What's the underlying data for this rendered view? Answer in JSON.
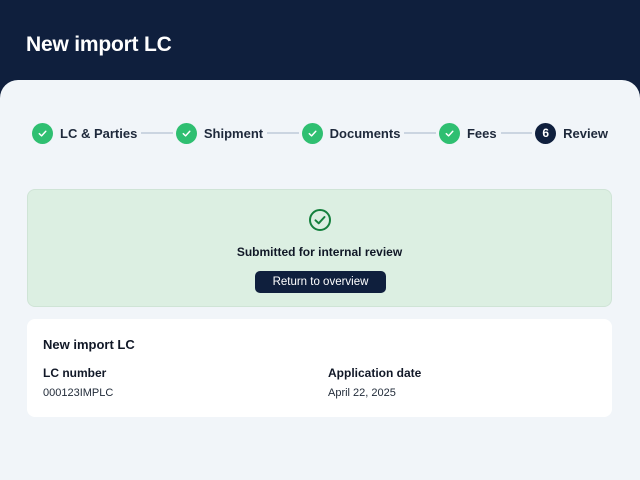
{
  "header": {
    "title": "New import LC"
  },
  "stepper": {
    "steps": [
      {
        "label": "LC & Parties",
        "status": "complete"
      },
      {
        "label": "Shipment",
        "status": "complete"
      },
      {
        "label": "Documents",
        "status": "complete"
      },
      {
        "label": "Fees",
        "status": "complete"
      },
      {
        "label": "Review",
        "status": "current",
        "number": "6"
      }
    ]
  },
  "success": {
    "icon": "check-circle-icon",
    "message": "Submitted for internal review",
    "button_label": "Return to overview"
  },
  "summary": {
    "title": "New import LC",
    "lc_number_label": "LC number",
    "lc_number_value": "000123IMPLC",
    "application_date_label": "Application date",
    "application_date_value": "April 22, 2025"
  },
  "colors": {
    "navy": "#0f1f3d",
    "success_green": "#2fbf71",
    "success_bg": "#dcefe2"
  }
}
